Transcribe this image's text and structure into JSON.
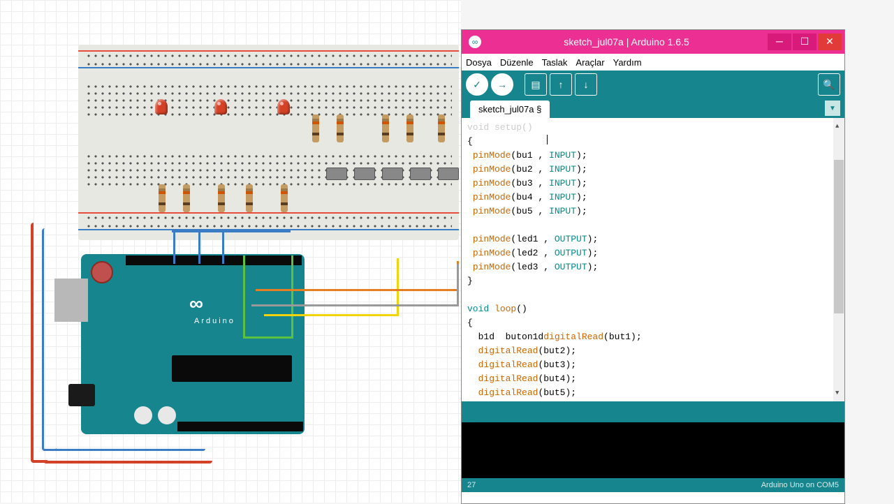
{
  "ide": {
    "title": "sketch_jul07a | Arduino 1.6.5",
    "menu": [
      "Dosya",
      "Düzenle",
      "Taslak",
      "Araçlar",
      "Yardım"
    ],
    "tab": "sketch_jul07a §",
    "footer_line": "27",
    "footer_board": "Arduino Uno on COM5"
  },
  "code": {
    "lines": [
      {
        "t": "plain",
        "s": "void setup()"
      },
      {
        "t": "plain",
        "s": "{"
      },
      {
        "t": "pin",
        "var": "bu1",
        "mode": "INPUT"
      },
      {
        "t": "pin",
        "var": "bu2",
        "mode": "INPUT"
      },
      {
        "t": "pin",
        "var": "bu3",
        "mode": "INPUT"
      },
      {
        "t": "pin",
        "var": "bu4",
        "mode": "INPUT"
      },
      {
        "t": "pin",
        "var": "bu5",
        "mode": "INPUT"
      },
      {
        "t": "blank"
      },
      {
        "t": "pin",
        "var": "led1",
        "mode": "OUTPUT"
      },
      {
        "t": "pin",
        "var": "led2",
        "mode": "OUTPUT"
      },
      {
        "t": "pin",
        "var": "led3",
        "mode": "OUTPUT"
      },
      {
        "t": "plain",
        "s": "}"
      },
      {
        "t": "blank"
      },
      {
        "t": "loop",
        "s": "void loop()"
      },
      {
        "t": "plain",
        "s": "{"
      },
      {
        "t": "read1",
        "pre": "  b1d  buton1d",
        "arg": "but1"
      },
      {
        "t": "read",
        "arg": "but2"
      },
      {
        "t": "read",
        "arg": "but3"
      },
      {
        "t": "read",
        "arg": "but4"
      },
      {
        "t": "read",
        "arg": "but5"
      }
    ]
  },
  "circuit": {
    "board": "Arduino",
    "board_sub": "UNO",
    "leds": 3,
    "resistors": 10,
    "buttons": 5
  }
}
